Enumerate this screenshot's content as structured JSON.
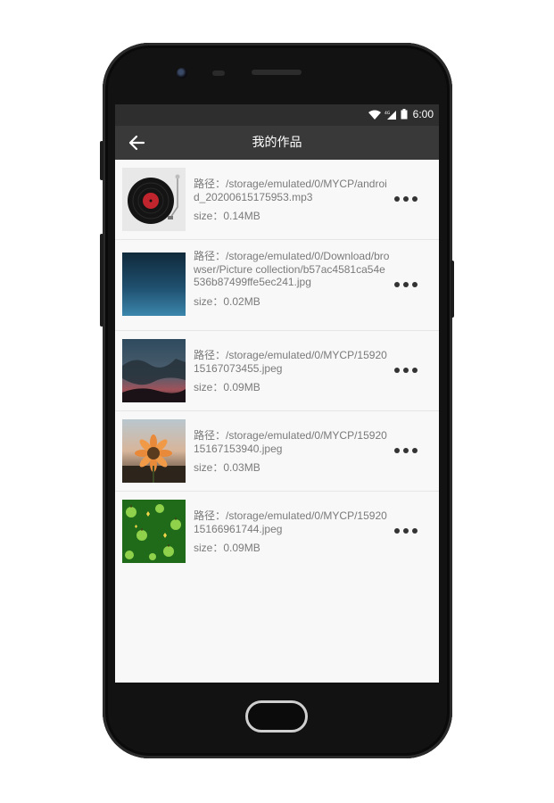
{
  "status_bar": {
    "time": "6:00",
    "icons": [
      "wifi-icon",
      "signal-icon",
      "battery-icon"
    ]
  },
  "app_bar": {
    "title": "我的作品",
    "back_icon": "arrow-left-icon"
  },
  "files": [
    {
      "path_label": "路径：",
      "path": "/storage/emulated/0/MYCP/android_20200615175953.mp3",
      "size_label": "size：",
      "size": "0.14MB",
      "thumbnail": "vinyl-record-thumbnail",
      "more_icon": "more-horizontal-icon"
    },
    {
      "path_label": "路径：",
      "path": "/storage/emulated/0/Download/browser/Picture collection/b57ac4581ca54e536b87499ffe5ec241.jpg",
      "size_label": "size：",
      "size": "0.02MB",
      "thumbnail": "blue-gradient-thumbnail",
      "more_icon": "more-horizontal-icon"
    },
    {
      "path_label": "路径：",
      "path": "/storage/emulated/0/MYCP/1592015167073455.jpeg",
      "size_label": "size：",
      "size": "0.09MB",
      "thumbnail": "dusk-sky-thumbnail",
      "more_icon": "more-horizontal-icon"
    },
    {
      "path_label": "路径：",
      "path": "/storage/emulated/0/MYCP/1592015167153940.jpeg",
      "size_label": "size：",
      "size": "0.03MB",
      "thumbnail": "sunflower-thumbnail",
      "more_icon": "more-horizontal-icon"
    },
    {
      "path_label": "路径：",
      "path": "/storage/emulated/0/MYCP/1592015166961744.jpeg",
      "size_label": "size：",
      "size": "0.09MB",
      "thumbnail": "green-apples-thumbnail",
      "more_icon": "more-horizontal-icon"
    }
  ],
  "colors": {
    "status_bar_bg": "#2e2e2e",
    "app_bar_bg": "#393939",
    "list_bg": "#f8f8f8",
    "text_secondary": "#7a7a7a"
  }
}
